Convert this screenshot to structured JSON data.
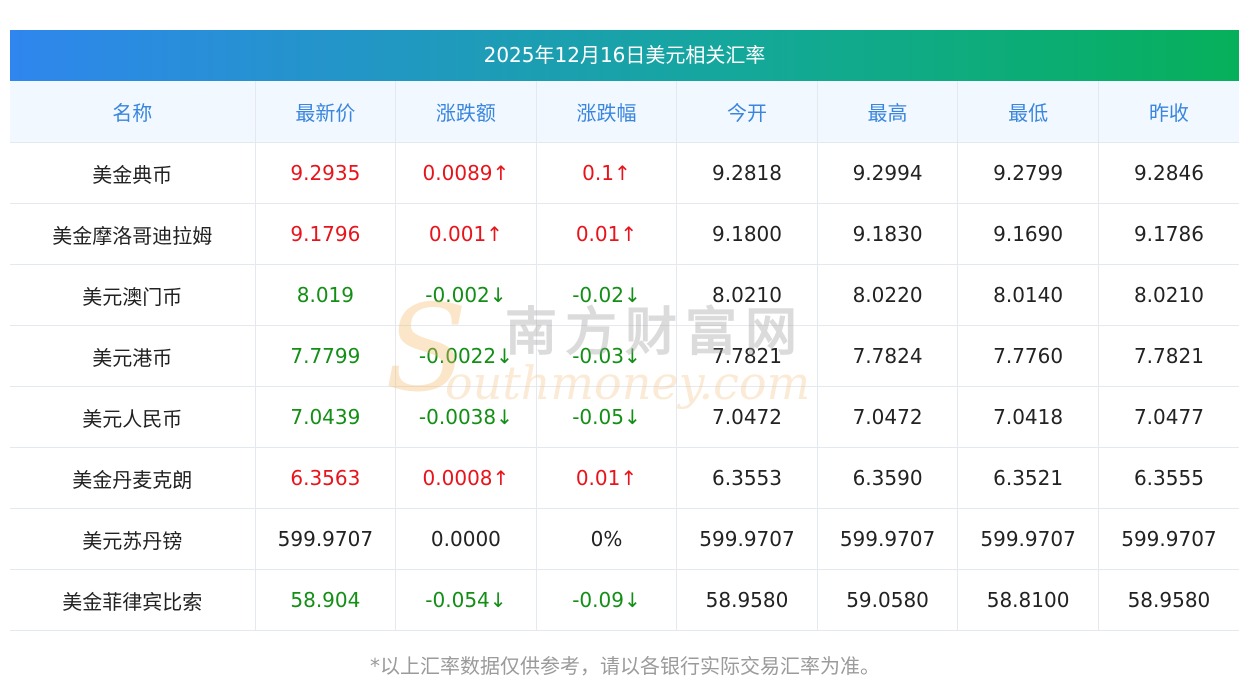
{
  "title": "2025年12月16日美元相关汇率",
  "columns": [
    "名称",
    "最新价",
    "涨跌额",
    "涨跌幅",
    "今开",
    "最高",
    "最低",
    "昨收"
  ],
  "rows": [
    {
      "name": "美金典币",
      "latest": "9.2935",
      "change": "0.0089↑",
      "pct": "0.1↑",
      "open": "9.2818",
      "high": "9.2994",
      "low": "9.2799",
      "prev": "9.2846",
      "trend": "up"
    },
    {
      "name": "美金摩洛哥迪拉姆",
      "latest": "9.1796",
      "change": "0.001↑",
      "pct": "0.01↑",
      "open": "9.1800",
      "high": "9.1830",
      "low": "9.1690",
      "prev": "9.1786",
      "trend": "up"
    },
    {
      "name": "美元澳门币",
      "latest": "8.019",
      "change": "-0.002↓",
      "pct": "-0.02↓",
      "open": "8.0210",
      "high": "8.0220",
      "low": "8.0140",
      "prev": "8.0210",
      "trend": "down"
    },
    {
      "name": "美元港币",
      "latest": "7.7799",
      "change": "-0.0022↓",
      "pct": "-0.03↓",
      "open": "7.7821",
      "high": "7.7824",
      "low": "7.7760",
      "prev": "7.7821",
      "trend": "down"
    },
    {
      "name": "美元人民币",
      "latest": "7.0439",
      "change": "-0.0038↓",
      "pct": "-0.05↓",
      "open": "7.0472",
      "high": "7.0472",
      "low": "7.0418",
      "prev": "7.0477",
      "trend": "down"
    },
    {
      "name": "美金丹麦克朗",
      "latest": "6.3563",
      "change": "0.0008↑",
      "pct": "0.01↑",
      "open": "6.3553",
      "high": "6.3590",
      "low": "6.3521",
      "prev": "6.3555",
      "trend": "up"
    },
    {
      "name": "美元苏丹镑",
      "latest": "599.9707",
      "change": "0.0000",
      "pct": "0%",
      "open": "599.9707",
      "high": "599.9707",
      "low": "599.9707",
      "prev": "599.9707",
      "trend": "flat"
    },
    {
      "name": "美金菲律宾比索",
      "latest": "58.904",
      "change": "-0.054↓",
      "pct": "-0.09↓",
      "open": "58.9580",
      "high": "59.0580",
      "low": "58.8100",
      "prev": "58.9580",
      "trend": "down"
    }
  ],
  "footnote": "*以上汇率数据仅供参考，请以各银行实际交易汇率为准。",
  "watermark": {
    "logo_letter": "S",
    "cn": "南方财富网",
    "en": "outhmoney.com"
  },
  "colors": {
    "up": "#e8141b",
    "down": "#138f16",
    "header_text": "#3a86de",
    "header_bg": "#f2f8ff"
  }
}
